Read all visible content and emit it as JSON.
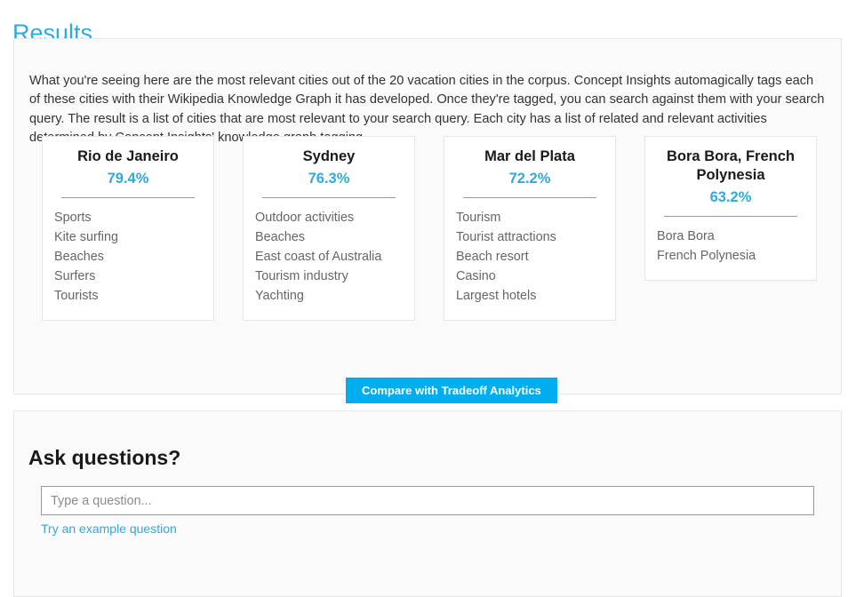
{
  "page": {
    "title": "Results"
  },
  "results_panel": {
    "intro": "What you're seeing here are the most relevant cities out of the 20 vacation cities in the corpus. Concept Insights automagically tags each of these cities with their Wikipedia Knowledge Graph it has developed. Once they're tagged, you can search against them with your search query. The result is a list of cities that are most relevant to your search query. Each city has a list of related and relevant activities determined by Concept Insights' knowledge graph tagging.",
    "cards": [
      {
        "name": "Rio de Janeiro",
        "score": "79.4%",
        "tags": [
          "Sports",
          "Kite surfing",
          "Beaches",
          "Surfers",
          "Tourists"
        ]
      },
      {
        "name": "Sydney",
        "score": "76.3%",
        "tags": [
          "Outdoor activities",
          "Beaches",
          "East coast of Australia",
          "Tourism industry",
          "Yachting"
        ]
      },
      {
        "name": "Mar del Plata",
        "score": "72.2%",
        "tags": [
          "Tourism",
          "Tourist attractions",
          "Beach resort",
          "Casino",
          "Largest hotels"
        ]
      },
      {
        "name": "Bora Bora, French Polynesia",
        "score": "63.2%",
        "tags": [
          "Bora Bora",
          "French Polynesia"
        ]
      }
    ],
    "compare_button_label": "Compare with Tradeoff Analytics"
  },
  "ask_panel": {
    "heading": "Ask questions?",
    "input_value": "",
    "input_placeholder": "Type a question...",
    "example_link_label": "Try an example question"
  },
  "colors": {
    "accent": "#2eaae0",
    "button": "#00aeef",
    "panel_bg": "#fafafa",
    "card_bg": "#ffffff",
    "tag_text": "#666666"
  }
}
